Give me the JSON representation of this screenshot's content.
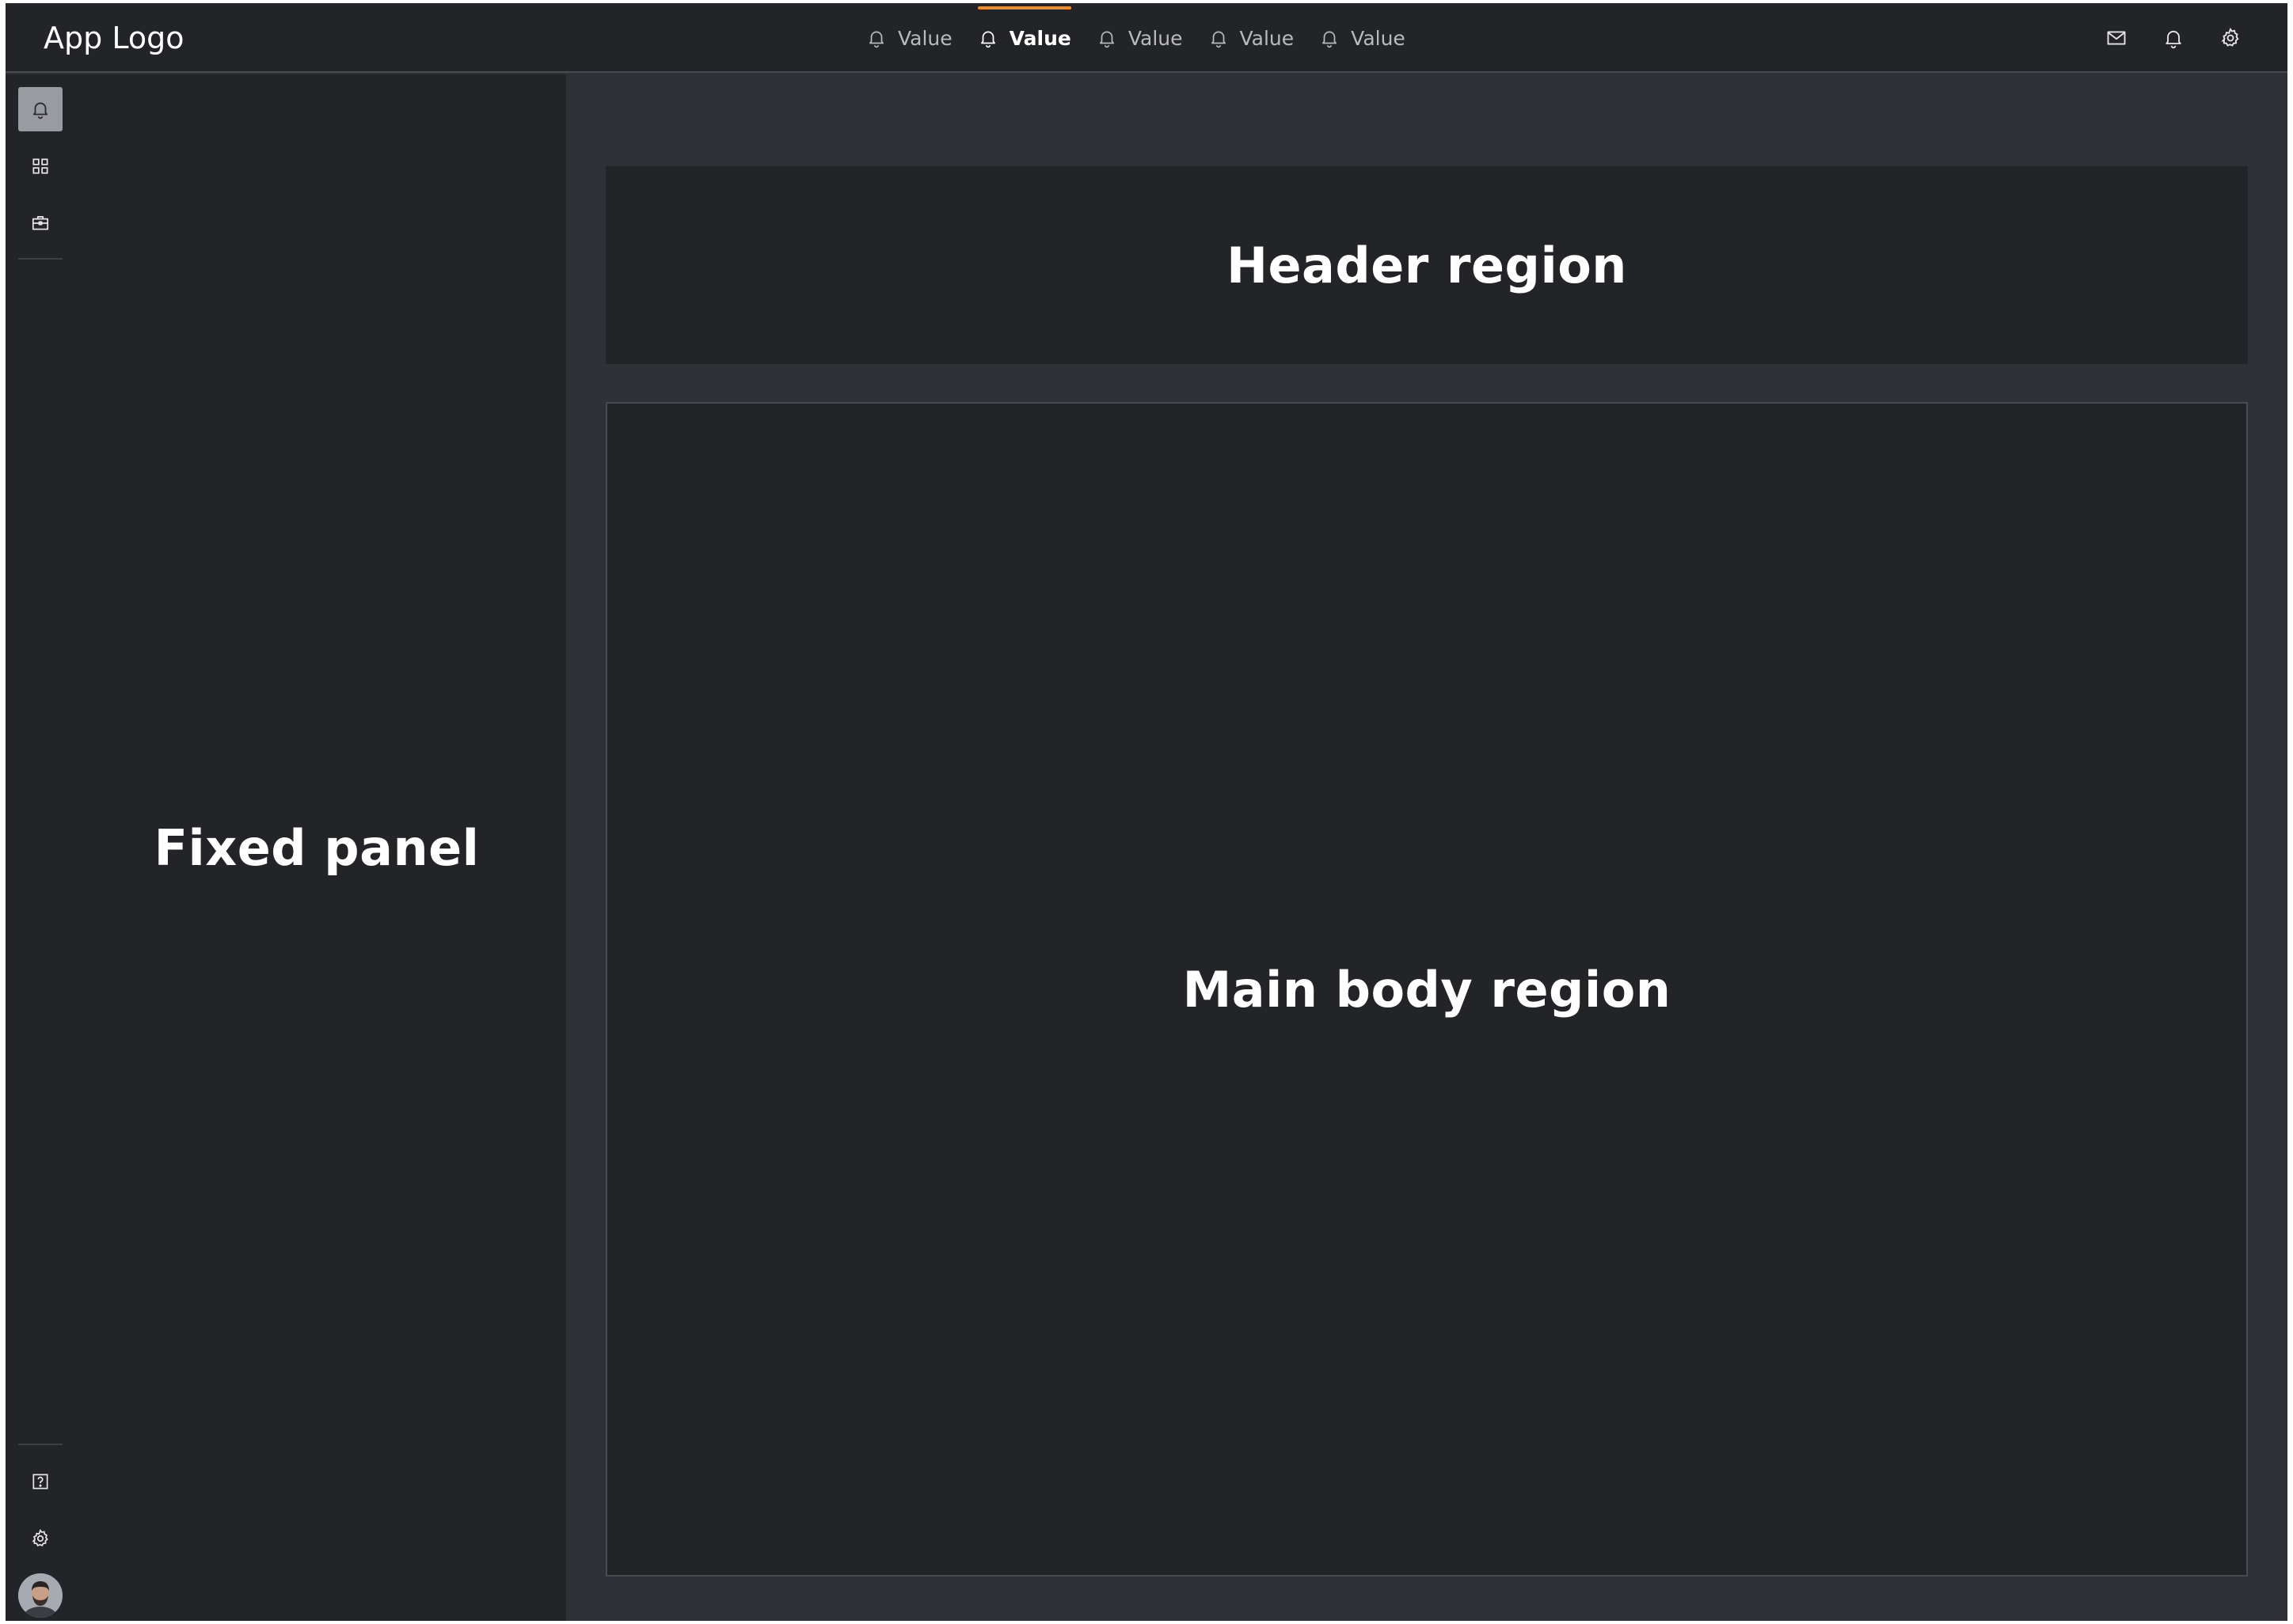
{
  "app": {
    "logo": "App Logo"
  },
  "topnav": {
    "tabs": [
      {
        "label": "Value",
        "icon": "bell-icon",
        "active": false
      },
      {
        "label": "Value",
        "icon": "bell-icon",
        "active": true
      },
      {
        "label": "Value",
        "icon": "bell-icon",
        "active": false
      },
      {
        "label": "Value",
        "icon": "bell-icon",
        "active": false
      },
      {
        "label": "Value",
        "icon": "bell-icon",
        "active": false
      }
    ],
    "actions": [
      "mail-icon",
      "bell-icon",
      "gear-icon"
    ],
    "accent_color": "#f08c2e"
  },
  "rail": {
    "top_items": [
      "bell-icon",
      "grid-icon",
      "briefcase-icon"
    ],
    "bottom_items": [
      "help-icon",
      "gear-icon",
      "avatar"
    ]
  },
  "regions": {
    "fixed_panel": "Fixed panel",
    "header": "Header region",
    "main_body": "Main body region"
  }
}
